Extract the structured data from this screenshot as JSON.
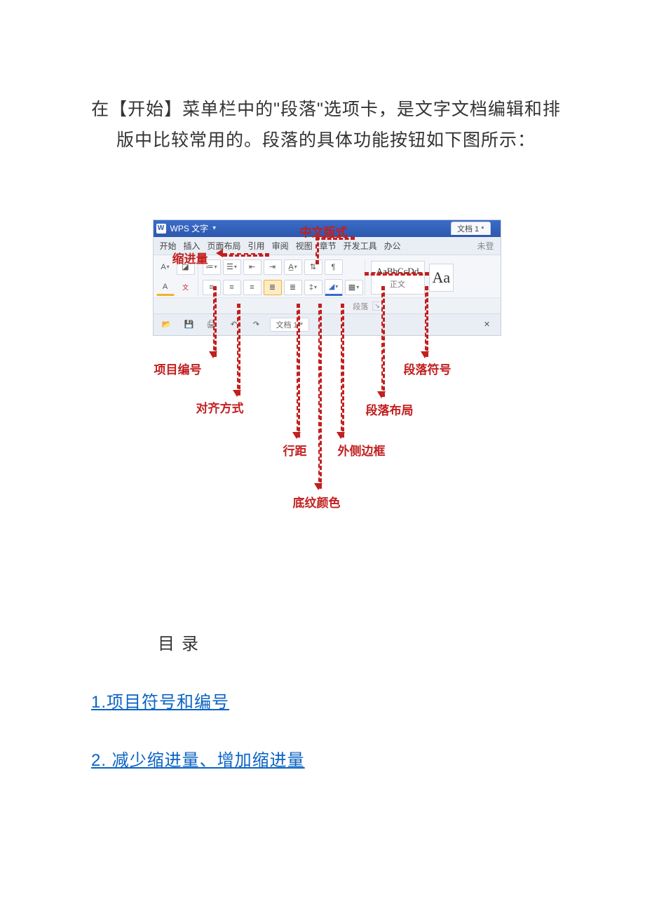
{
  "intro_text": "在【开始】菜单栏中的\"段落\"选项卡，是文字文档编辑和排版中比较常用的。段落的具体功能按钮如下图所示：",
  "wps": {
    "app_title": "WPS 文字",
    "doc_tab": "文档 1 *",
    "menus": [
      "开始",
      "插入",
      "页面布局",
      "引用",
      "审阅",
      "视图",
      "章节",
      "开发工具",
      "办公"
    ],
    "not_logged": "未登",
    "group_label": "段落",
    "style_sample": "AaBbCcDd",
    "style_name": "正文",
    "qat_doc": "文档 1 *"
  },
  "callouts": {
    "chinese_format": "中文版式",
    "indent": "缩进量",
    "bullets": "项目编号",
    "align": "对齐方式",
    "line_spacing": "行距",
    "shading": "底纹颜色",
    "border": "外侧边框",
    "layout": "段落布局",
    "para_symbol": "段落符号"
  },
  "toc": {
    "title": "目录",
    "items": [
      "1.项目符号和编号",
      "2. 减少缩进量、增加缩进量"
    ]
  }
}
